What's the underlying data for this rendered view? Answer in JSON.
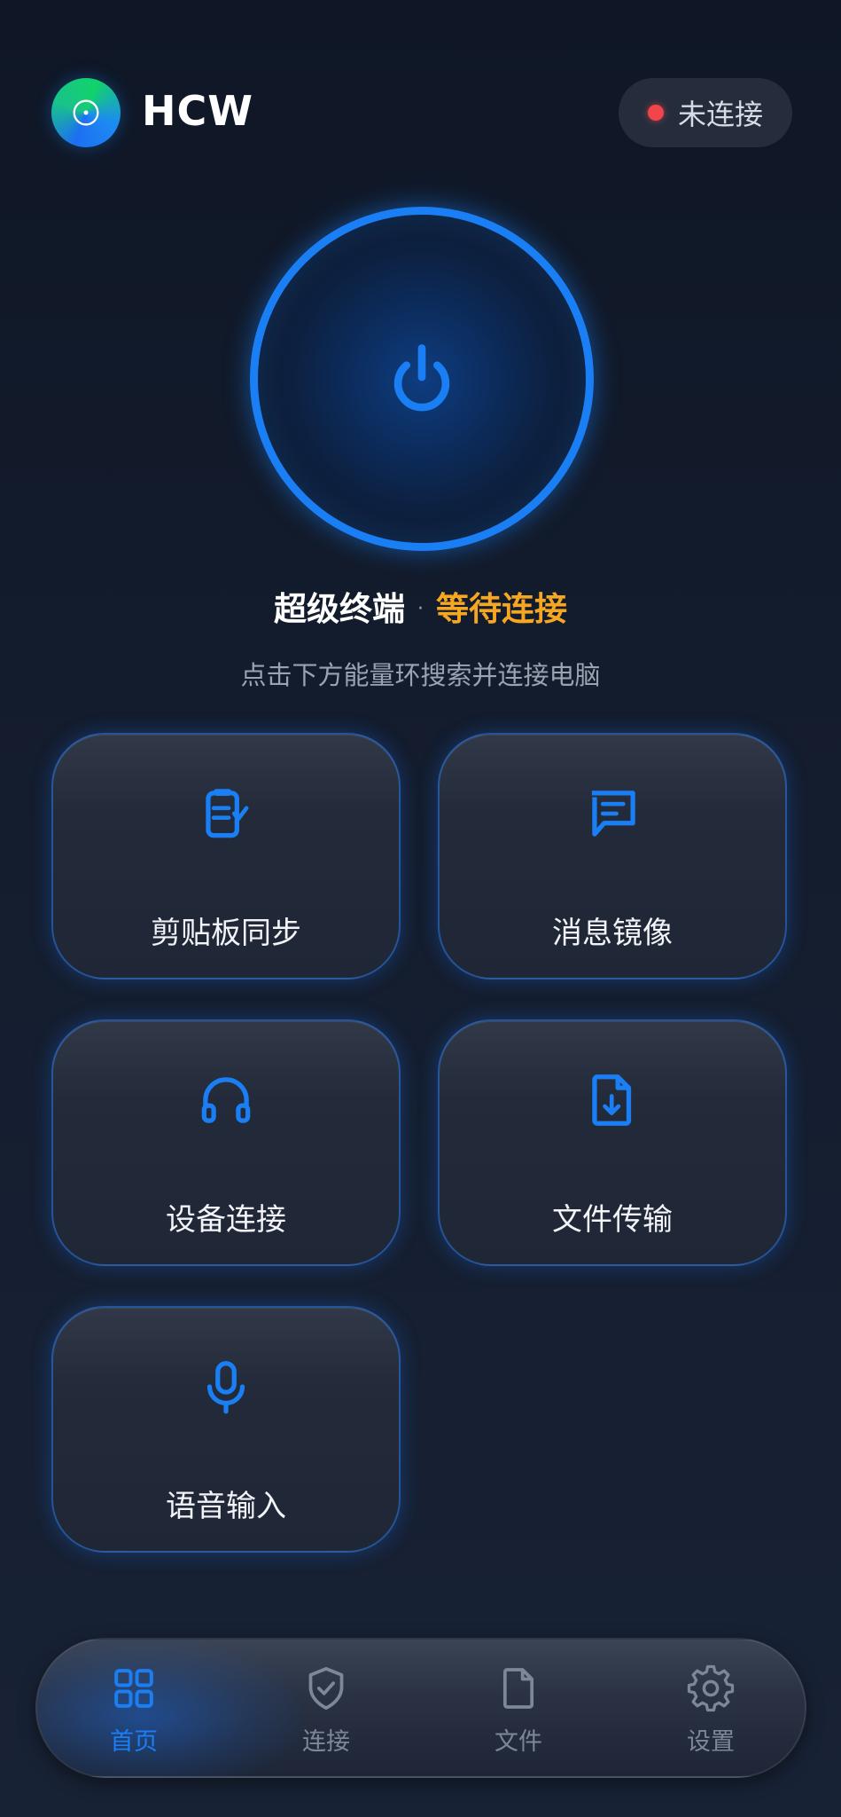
{
  "header": {
    "app_name": "HCW",
    "connection_status": "未连接",
    "status_color": "#f0454a"
  },
  "power": {
    "icon": "power-icon",
    "title": "超级终端",
    "separator": "·",
    "state": "等待连接",
    "state_color": "#f5a623",
    "hint": "点击下方能量环搜索并连接电脑"
  },
  "features": [
    {
      "label": "剪贴板同步",
      "icon": "clipboard-check-icon"
    },
    {
      "label": "消息镜像",
      "icon": "message-icon"
    },
    {
      "label": "设备连接",
      "icon": "headphones-icon"
    },
    {
      "label": "文件传输",
      "icon": "file-download-icon"
    },
    {
      "label": "语音输入",
      "icon": "microphone-icon"
    }
  ],
  "nav": {
    "items": [
      {
        "label": "首页",
        "icon": "grid-icon",
        "active": true
      },
      {
        "label": "连接",
        "icon": "shield-check-icon",
        "active": false
      },
      {
        "label": "文件",
        "icon": "file-icon",
        "active": false
      },
      {
        "label": "设置",
        "icon": "gear-icon",
        "active": false
      }
    ]
  },
  "colors": {
    "accent": "#1a7ff5",
    "background": "#141d2e",
    "warning": "#f5a623"
  }
}
